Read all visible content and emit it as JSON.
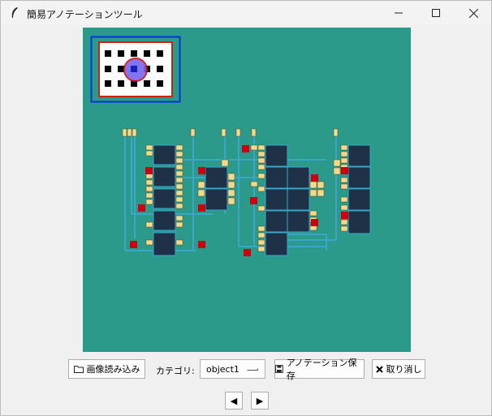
{
  "window": {
    "title": "簡易アノテーションツール"
  },
  "toolbar": {
    "load_label": "画像読み込み",
    "category_label": "カテゴリ:",
    "category_value": "object1",
    "save_label": "アノテーション保存",
    "undo_label": "取り消し"
  },
  "nav": {
    "prev_glyph": "◀",
    "next_glyph": "▶"
  },
  "colors": {
    "canvas_bg": "#2b9a8b",
    "chip": "#1f3146",
    "pad": "#f5d98b",
    "via": "#cc0011",
    "wire": "#3aa6c9",
    "annotation_box": "#0033dd"
  }
}
